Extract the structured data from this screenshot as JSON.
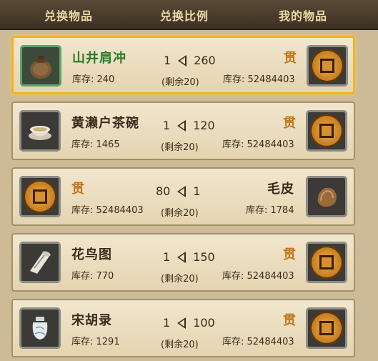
{
  "header": {
    "col1": "兑换物品",
    "col2": "兑换比例",
    "col3": "我的物品"
  },
  "rows": [
    {
      "give_name": "山井肩冲",
      "give_stock": "库存: 240",
      "ratio_left": "1",
      "ratio_right": "260",
      "remain": "(剩余20)",
      "get_name": "贯",
      "get_stock": "库存: 52484403"
    },
    {
      "give_name": "黄濑户茶碗",
      "give_stock": "库存: 1465",
      "ratio_left": "1",
      "ratio_right": "120",
      "remain": "(剩余20)",
      "get_name": "贯",
      "get_stock": "库存: 52484403"
    },
    {
      "give_name": "贯",
      "give_stock": "库存: 52484403",
      "ratio_left": "80",
      "ratio_right": "1",
      "remain": "(剩余20)",
      "get_name": "毛皮",
      "get_stock": "库存: 1784"
    },
    {
      "give_name": "花鸟图",
      "give_stock": "库存: 770",
      "ratio_left": "1",
      "ratio_right": "150",
      "remain": "(剩余20)",
      "get_name": "贯",
      "get_stock": "库存: 52484403"
    },
    {
      "give_name": "宋胡录",
      "give_stock": "库存: 1291",
      "ratio_left": "1",
      "ratio_right": "100",
      "remain": "(剩余20)",
      "get_name": "贯",
      "get_stock": "库存: 52484403"
    }
  ],
  "icons": {
    "row0_left": "tea-jar-icon",
    "row1_left": "tea-bowl-icon",
    "row2_right": "fur-pelt-icon",
    "row3_left": "scroll-icon",
    "row4_left": "porcelain-jar-icon",
    "currency": "coin-icon"
  },
  "colors": {
    "selected_border": "#f0b429",
    "item_name_selected": "#2a7a2a",
    "currency_text": "#c2771c"
  }
}
